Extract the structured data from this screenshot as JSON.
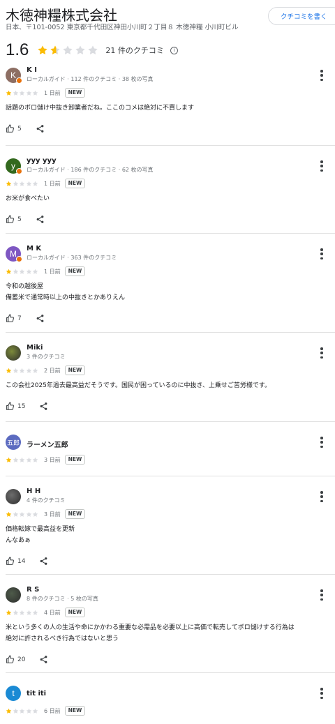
{
  "place": {
    "name": "木徳神糧株式会社",
    "address": "日本、〒101-0052 東京都千代田区神田小川町２丁目８ 木徳神糧 小川町ビル",
    "write_review_label": "クチコミを書く",
    "rating": "1.6",
    "rating_value": 1.6,
    "review_count": "21 件のクチコミ",
    "info_glyph": "i"
  },
  "ui": {
    "new_badge": "NEW"
  },
  "reviews": [
    {
      "author": "K I",
      "initial": "K",
      "avatar_color": "#8d6e63",
      "local_guide": true,
      "meta": "ローカルガイド · 112 件のクチコミ · 38 枚の写真",
      "stars": 1,
      "date": "1 日前",
      "text": [
        "話題のボロ儲け中抜き卸業者だね。ここのコメは絶対に不買します"
      ],
      "likes": "5"
    },
    {
      "author": "yyy yyy",
      "initial": "y",
      "avatar_color": "#33691e",
      "local_guide": true,
      "meta": "ローカルガイド · 186 件のクチコミ · 62 枚の写真",
      "stars": 1,
      "date": "1 日前",
      "text": [
        "お米が食べたい"
      ],
      "likes": "5"
    },
    {
      "author": "M K",
      "initial": "M",
      "avatar_color": "#7e57c2",
      "local_guide": true,
      "meta": "ローカルガイド · 363 件のクチコミ",
      "stars": 1,
      "date": "1 日前",
      "text": [
        "令和の越後屋",
        "備蓄米で通常時以上の中抜きとかありえん"
      ],
      "likes": "7"
    },
    {
      "author": "Miki",
      "initial": "",
      "avatar_color": "#7c8a3a",
      "local_guide": false,
      "meta": "3 件のクチコミ",
      "stars": 1,
      "date": "2 日前",
      "text": [
        "この会社2025年過去最高益だそうです。国民が困っているのに中抜き、上乗せご苦労様です。"
      ],
      "likes": "15"
    },
    {
      "author": "ラーメン五郎",
      "initial": "五郎",
      "avatar_color": "#5c6bc0",
      "local_guide": false,
      "meta": "",
      "stars": 1,
      "date": "3 日前",
      "text": [],
      "likes": ""
    },
    {
      "author": "H H",
      "initial": "",
      "avatar_color": "#6d6d6d",
      "local_guide": false,
      "meta": "4 件のクチコミ",
      "stars": 1,
      "date": "3 日前",
      "text": [
        "価格転嫁で最高益を更新",
        "んなあぁ"
      ],
      "likes": "14"
    },
    {
      "author": "R S",
      "initial": "",
      "avatar_color": "#4e5b4a",
      "local_guide": false,
      "meta": "8 件のクチコミ · 5 枚の写真",
      "stars": 1,
      "date": "4 日前",
      "text": [
        "米という多くの人の生活や命にかかわる重要な必需品を必要以上に高価で転売してボロ儲けする行為は",
        "絶対に許されるべき行為ではないと思う"
      ],
      "likes": "20"
    },
    {
      "author": "tit iti",
      "initial": "t",
      "avatar_color": "#1a8ad4",
      "local_guide": false,
      "meta": "",
      "stars": 1,
      "date": "6 日前",
      "text": [],
      "likes": ""
    }
  ]
}
